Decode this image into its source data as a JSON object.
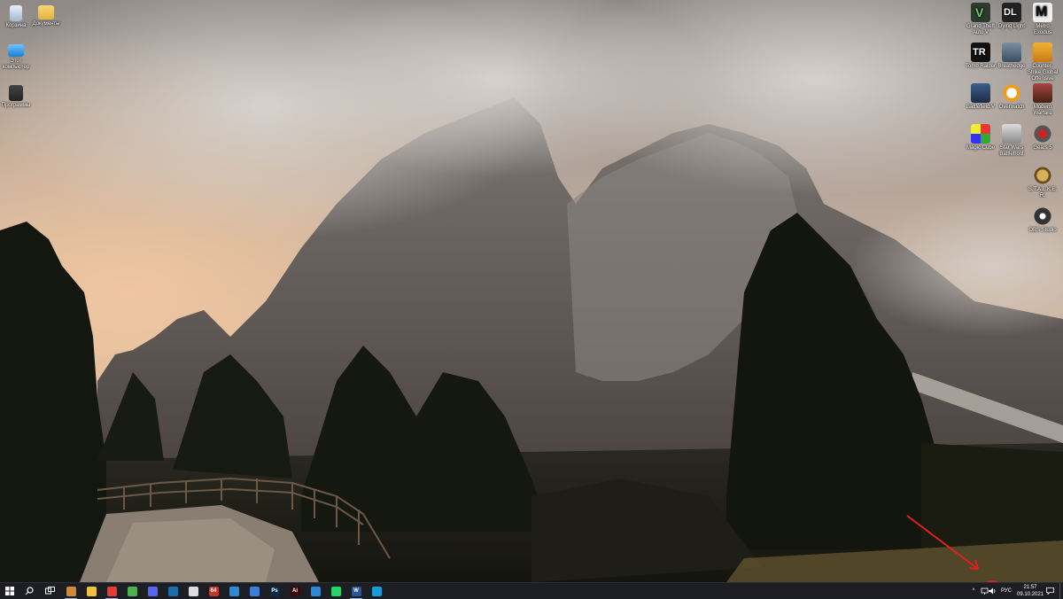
{
  "desktop_icons_left": [
    {
      "name": "recycle-bin-icon",
      "label": "Корзина"
    },
    {
      "name": "folder-icon",
      "label": "Документы"
    },
    {
      "name": "this-pc-icon",
      "label": "Этот компьютер"
    },
    {
      "name": "programs-icon",
      "label": "Программы"
    }
  ],
  "desktop_icons_right": [
    {
      "name": "gta-v-icon",
      "label": "Grand Theft Auto V"
    },
    {
      "name": "dying-light-icon",
      "label": "Dying Light"
    },
    {
      "name": "metro-icon",
      "label": "Metro Exodus"
    },
    {
      "name": "tomb-raider-icon",
      "label": "Tomb Raider"
    },
    {
      "name": "breathedge-icon",
      "label": "Breathedge"
    },
    {
      "name": "csgo-icon",
      "label": "Counter-Strike Global Offensive"
    },
    {
      "name": "battlefield-icon",
      "label": "Battlefield V"
    },
    {
      "name": "overwatch-icon",
      "label": "Overwatch"
    },
    {
      "name": "modern-warfare-icon",
      "label": "Modern Warfare"
    },
    {
      "name": "rubiks-icon",
      "label": "Magic Cube"
    },
    {
      "name": "star-wars-icon",
      "label": "Star Wars Battlefront"
    },
    {
      "name": "gears-icon",
      "label": "Gears 5"
    },
    {
      "name": "stalker-icon",
      "label": "S.T.A.L.K.E.R."
    },
    {
      "name": "obs-icon",
      "label": "OBS Studio"
    }
  ],
  "taskbar": {
    "apps": [
      {
        "name": "media-app-icon",
        "color": "#d08a30"
      },
      {
        "name": "file-explorer-icon",
        "color": "#f0c040"
      },
      {
        "name": "yandex-browser-icon",
        "color": "#e83a2f"
      },
      {
        "name": "chrome-icon",
        "color": "#4caf50"
      },
      {
        "name": "discord-icon",
        "color": "#5865f2"
      },
      {
        "name": "steam-icon",
        "color": "#1b6fa8"
      },
      {
        "name": "obs-taskbar-icon",
        "color": "#dddddd"
      },
      {
        "name": "aida64-icon",
        "color": "#c0392b",
        "text": "64"
      },
      {
        "name": "wallpaper-app-icon",
        "color": "#2b8bd6"
      },
      {
        "name": "calculator-icon",
        "color": "#3b7dd8"
      },
      {
        "name": "photoshop-icon",
        "color": "#0a2a4a",
        "text": "Ps"
      },
      {
        "name": "adobe-app-icon",
        "color": "#3a0a0a",
        "text": "Ai"
      },
      {
        "name": "vscode-icon",
        "color": "#2a8ad8"
      },
      {
        "name": "whatsapp-icon",
        "color": "#25d366"
      },
      {
        "name": "word-icon",
        "color": "#2b579a",
        "text": "W"
      },
      {
        "name": "photos-icon",
        "color": "#1a9bd7"
      }
    ],
    "tray": {
      "chevron": "^",
      "language": "РУС",
      "time": "21:57",
      "date": "09.10.2021"
    }
  }
}
